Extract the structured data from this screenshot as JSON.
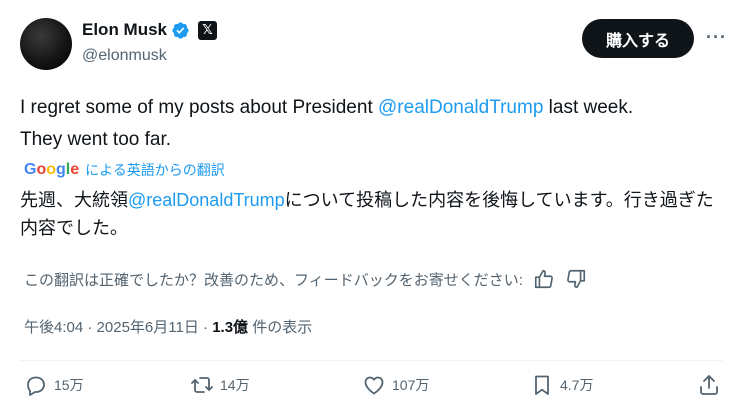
{
  "author": {
    "display_name": "Elon Musk",
    "handle": "@elonmusk",
    "x_badge": "𝕏"
  },
  "header": {
    "buy_button": "購入する",
    "more": "···"
  },
  "tweet": {
    "line1_prefix": "I regret some of my posts about President ",
    "mention": "@realDonaldTrump",
    "line1_suffix": " last week.",
    "line2": "They went too far."
  },
  "translation": {
    "google_label": "Google",
    "translated_by": "による英語からの翻訳",
    "prefix": "先週、大統領",
    "mention": "@realDonaldTrump",
    "suffix": "について投稿した内容を後悔しています。行き過ぎた内容でした。",
    "feedback_question": "この翻訳は正確でしたか？改善のため、フィードバックをお寄せください:"
  },
  "meta": {
    "time": "午後4:04",
    "sep1": " · ",
    "date": "2025年6月11日",
    "sep2": " · ",
    "views": "1.3億",
    "views_label": " 件の表示"
  },
  "actions": {
    "replies": "15万",
    "reposts": "14万",
    "likes": "107万",
    "bookmarks": "4.7万"
  },
  "colors": {
    "accent": "#1d9bf0",
    "text": "#0f1419",
    "muted": "#536471"
  }
}
